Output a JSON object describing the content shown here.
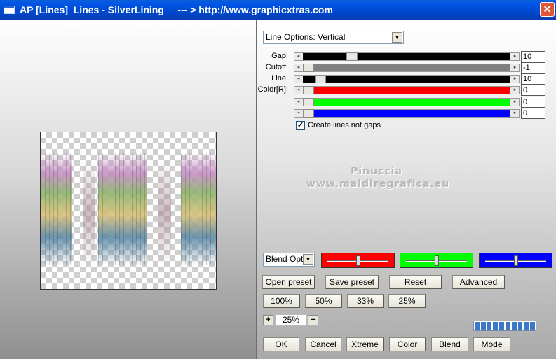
{
  "window": {
    "title": "AP [Lines]  Lines - SilverLining     --- > http://www.graphicxtras.com",
    "close_glyph": "✕"
  },
  "options": {
    "line_options_selected": "Line Options: Vertical",
    "blend_options_selected": "Blend Optio"
  },
  "sliders": [
    {
      "label": "Gap:",
      "value": "10",
      "level": 0.22,
      "fill": "#000000"
    },
    {
      "label": "Cutoff:",
      "value": "-1",
      "level": 0.0,
      "fill": "#808080"
    },
    {
      "label": "Line:",
      "value": "10",
      "level": 0.06,
      "fill": "#000000"
    },
    {
      "label": "Color[R]:",
      "value": "0",
      "level": 0.0,
      "fill": "#ff0000"
    },
    {
      "label": "",
      "value": "0",
      "level": 0.0,
      "fill": "#00ff00"
    },
    {
      "label": "",
      "value": "0",
      "level": 0.0,
      "fill": "#0000ff"
    }
  ],
  "checkbox": {
    "label": "Create lines not gaps",
    "checked": true,
    "mark": "✔"
  },
  "watermark": {
    "line1": "Pinuccia",
    "line2": "www.maldiregrafica.eu"
  },
  "color_swatches": [
    {
      "color": "#ff0000",
      "level": 0.5
    },
    {
      "color": "#00ff00",
      "level": 0.5
    },
    {
      "color": "#0000ff",
      "level": 0.5
    }
  ],
  "buttons": {
    "open_preset": "Open preset",
    "save_preset": "Save preset",
    "reset": "Reset",
    "advanced": "Advanced",
    "zoom_100": "100%",
    "zoom_50": "50%",
    "zoom_33": "33%",
    "zoom_25": "25%",
    "ok": "OK",
    "cancel": "Cancel",
    "xtreme": "Xtreme",
    "color": "Color",
    "blend": "Blend",
    "mode": "Mode"
  },
  "zoom": {
    "value": "25%",
    "plus": "+",
    "minus": "−"
  },
  "progress": {
    "segments": 10,
    "filled": 10
  },
  "icons": {
    "window_icon": "window-icon",
    "close_icon": "close-icon",
    "dropdown_arrow": "chevron-down-icon"
  }
}
